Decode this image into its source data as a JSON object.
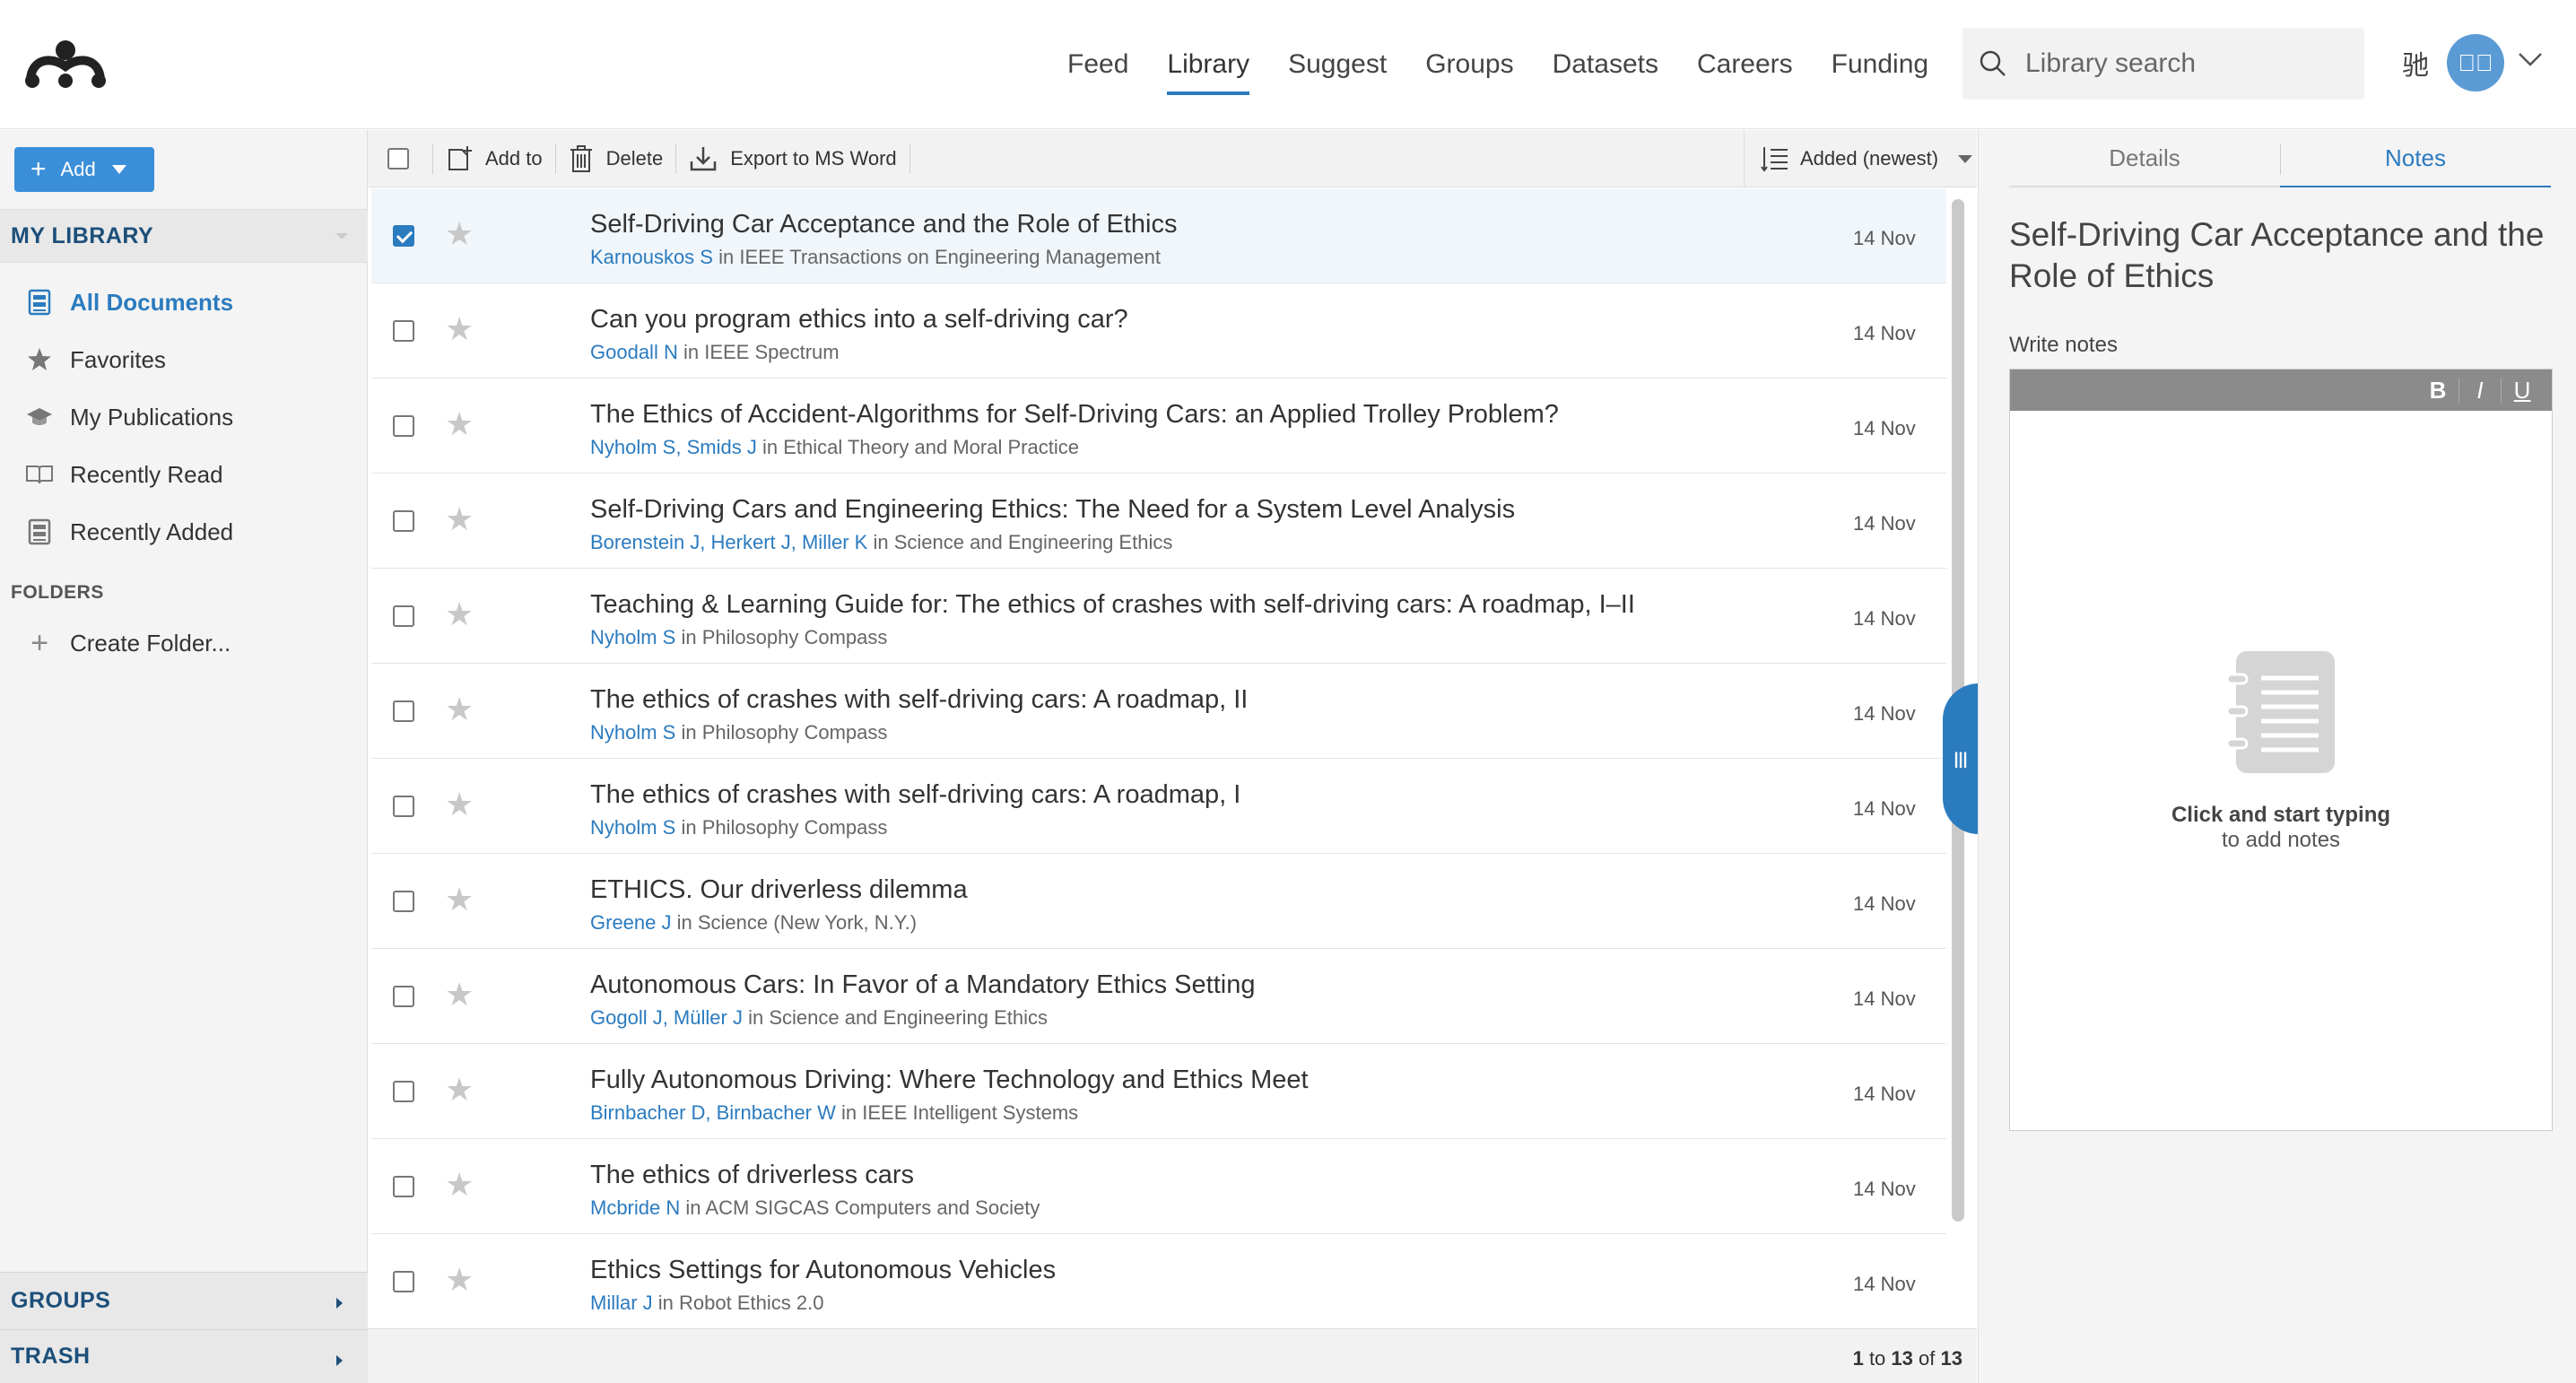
{
  "nav": {
    "items": [
      "Feed",
      "Library",
      "Suggest",
      "Groups",
      "Datasets",
      "Careers",
      "Funding"
    ],
    "active": "Library"
  },
  "search": {
    "placeholder": "Library search",
    "value": ""
  },
  "user": {
    "glyph": "驰",
    "avatar_text": "󰀀󰀀"
  },
  "sidebar": {
    "add_label": "Add",
    "my_library": "MY LIBRARY",
    "items": [
      {
        "label": "All Documents",
        "icon": "document-stack-icon",
        "active": true
      },
      {
        "label": "Favorites",
        "icon": "star-icon",
        "active": false
      },
      {
        "label": "My Publications",
        "icon": "graduation-cap-icon",
        "active": false
      },
      {
        "label": "Recently Read",
        "icon": "open-book-icon",
        "active": false
      },
      {
        "label": "Recently Added",
        "icon": "list-stack-icon",
        "active": false
      }
    ],
    "folders_heading": "FOLDERS",
    "create_folder": "Create Folder...",
    "groups": "GROUPS",
    "trash": "TRASH"
  },
  "toolbar": {
    "add_to": "Add to",
    "delete": "Delete",
    "export": "Export to MS Word",
    "sort": "Added (newest)"
  },
  "documents": [
    {
      "title": "Self-Driving Car Acceptance and the Role of Ethics",
      "authors": "Karnouskos S",
      "source": "IEEE Transactions on Engineering Management",
      "date": "14 Nov",
      "checked": true
    },
    {
      "title": "Can you program ethics into a self-driving car?",
      "authors": "Goodall N",
      "source": "IEEE Spectrum",
      "date": "14 Nov",
      "checked": false
    },
    {
      "title": "The Ethics of Accident-Algorithms for Self-Driving Cars: an Applied Trolley Problem?",
      "authors": "Nyholm S, Smids J",
      "source": "Ethical Theory and Moral Practice",
      "date": "14 Nov",
      "checked": false
    },
    {
      "title": "Self-Driving Cars and Engineering Ethics: The Need for a System Level Analysis",
      "authors": "Borenstein J, Herkert J, Miller K",
      "source": "Science and Engineering Ethics",
      "date": "14 Nov",
      "checked": false
    },
    {
      "title": "Teaching & Learning Guide for: The ethics of crashes with self-driving cars: A roadmap, I–II",
      "authors": "Nyholm S",
      "source": "Philosophy Compass",
      "date": "14 Nov",
      "checked": false
    },
    {
      "title": "The ethics of crashes with self-driving cars: A roadmap, II",
      "authors": "Nyholm S",
      "source": "Philosophy Compass",
      "date": "14 Nov",
      "checked": false
    },
    {
      "title": "The ethics of crashes with self-driving cars: A roadmap, I",
      "authors": "Nyholm S",
      "source": "Philosophy Compass",
      "date": "14 Nov",
      "checked": false
    },
    {
      "title": "ETHICS. Our driverless dilemma",
      "authors": "Greene J",
      "source": "Science (New York, N.Y.)",
      "date": "14 Nov",
      "checked": false
    },
    {
      "title": "Autonomous Cars: In Favor of a Mandatory Ethics Setting",
      "authors": "Gogoll J, Müller J",
      "source": "Science and Engineering Ethics",
      "date": "14 Nov",
      "checked": false
    },
    {
      "title": "Fully Autonomous Driving: Where Technology and Ethics Meet",
      "authors": "Birnbacher D, Birnbacher W",
      "source": "IEEE Intelligent Systems",
      "date": "14 Nov",
      "checked": false
    },
    {
      "title": "The ethics of driverless cars",
      "authors": "Mcbride N",
      "source": "ACM SIGCAS Computers and Society",
      "date": "14 Nov",
      "checked": false
    },
    {
      "title": "Ethics Settings for Autonomous Vehicles",
      "authors": "Millar J",
      "source": "Robot Ethics 2.0",
      "date": "14 Nov",
      "checked": false
    }
  ],
  "meta_in": "in",
  "pagination": {
    "from": "1",
    "to_word": "to",
    "to": "13",
    "of_word": "of",
    "total": "13"
  },
  "panel_handle": "|||",
  "right_panel": {
    "tabs": [
      "Details",
      "Notes"
    ],
    "active_tab": "Notes",
    "doc_title": "Self-Driving Car Acceptance and the Role of Ethics",
    "write_notes": "Write notes",
    "format_buttons": [
      "B",
      "I",
      "U"
    ],
    "empty_line1": "Click and start typing",
    "empty_line2": "to add notes"
  },
  "colors": {
    "accent": "#2b7bbf",
    "add_button": "#3b8fd9",
    "selected_row": "#f1f6fb"
  }
}
